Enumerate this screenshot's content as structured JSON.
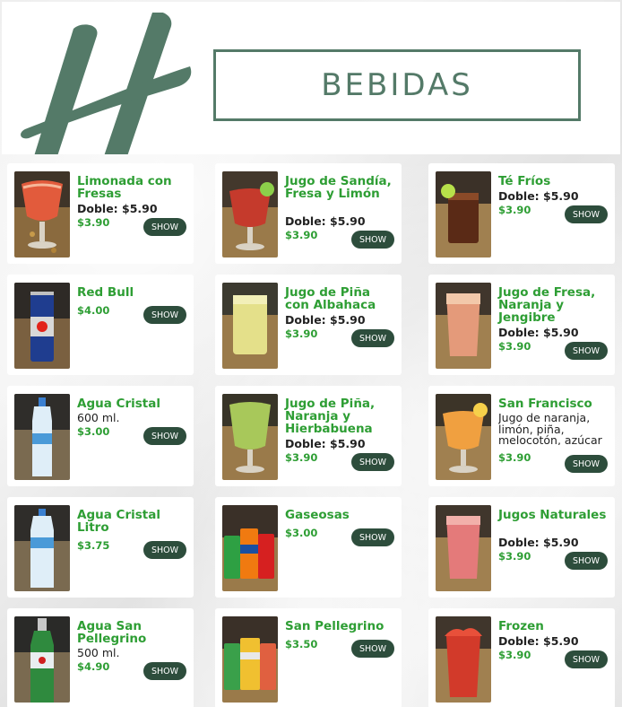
{
  "header": {
    "title": "BEBIDAS",
    "logo_icon": "holiday-inn-h-logo",
    "brand_color": "#547a68"
  },
  "colors": {
    "name_green": "#2e9e34",
    "button_bg": "#2d4d3c",
    "card_bg": "#ffffff"
  },
  "items": [
    {
      "name": "Limonada con Fresas",
      "sub": "Doble: $5.90",
      "price": "$3.90",
      "button": "SHOW",
      "image": "strawberry-lemonade-glass"
    },
    {
      "name": "Jugo de Sandía, Fresa y Limón",
      "sub": "Doble: $5.90",
      "price": "$3.90",
      "button": "SHOW",
      "image": "watermelon-juice-glass"
    },
    {
      "name": "Té Fríos",
      "sub": "Doble: $5.90",
      "price": "$3.90",
      "button": "SHOW",
      "image": "iced-tea-glass"
    },
    {
      "name": "Red Bull",
      "price": "$4.00",
      "button": "SHOW",
      "image": "red-bull-can"
    },
    {
      "name": "Jugo de Piña con Albahaca",
      "sub": "Doble: $5.90",
      "price": "$3.90",
      "button": "SHOW",
      "image": "pineapple-basil-juice-glass"
    },
    {
      "name": "Jugo de Fresa, Naranja y Jengibre",
      "sub": "Doble: $5.90",
      "price": "$3.90",
      "button": "SHOW",
      "image": "strawberry-orange-ginger-juice-glass"
    },
    {
      "name": "Agua Cristal",
      "desc": "600 ml.",
      "price": "$3.00",
      "button": "SHOW",
      "image": "water-bottle"
    },
    {
      "name": "Jugo de Piña, Naranja y Hierbabuena",
      "sub": "Doble: $5.90",
      "price": "$3.90",
      "button": "SHOW",
      "image": "pineapple-orange-mint-juice-glass"
    },
    {
      "name": "San Francisco",
      "desc": "Jugo de naranja, limón, piña, melocotón, azúcar y",
      "price": "$3.90",
      "button": "SHOW",
      "image": "san-francisco-cocktail-glass"
    },
    {
      "name": "Agua Cristal Litro",
      "price": "$3.75",
      "button": "SHOW",
      "image": "water-bottle-liter"
    },
    {
      "name": "Gaseosas",
      "price": "$3.00",
      "button": "SHOW",
      "image": "soda-cans"
    },
    {
      "name": "Jugos Naturales",
      "sub": "Doble: $5.90",
      "price": "$3.90",
      "button": "SHOW",
      "image": "natural-juice-glass"
    },
    {
      "name": "Agua San Pellegrino",
      "desc": "500 ml.",
      "price": "$4.90",
      "button": "SHOW",
      "image": "san-pellegrino-bottle"
    },
    {
      "name": "San Pellegrino",
      "price": "$3.50",
      "button": "SHOW",
      "image": "san-pellegrino-cans"
    },
    {
      "name": "Frozen",
      "sub": "Doble: $5.90",
      "price": "$3.90",
      "button": "SHOW",
      "image": "frozen-drink-glass"
    }
  ]
}
